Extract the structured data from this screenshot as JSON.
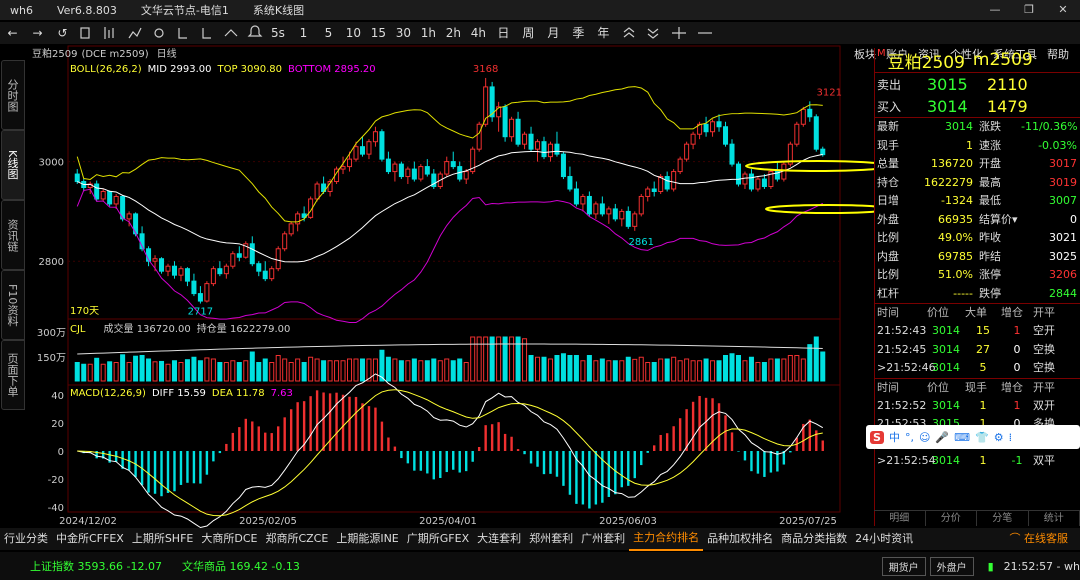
{
  "window": {
    "title": "wh6",
    "version": "Ver6.8.803",
    "server": "文华云节点-电信1",
    "screen": "系统K线图",
    "controls": [
      "—",
      "❐",
      "✕"
    ]
  },
  "toolbar": {
    "nav": [
      "←",
      "→",
      "↺"
    ],
    "periods": [
      "1",
      "5",
      "10",
      "15",
      "30",
      "1h",
      "2h",
      "4h",
      "日",
      "周",
      "月",
      "季",
      "年"
    ],
    "menu": [
      "板块",
      "账户",
      "资讯",
      "个性化",
      "系统工具",
      "帮助"
    ]
  },
  "left_tabs": [
    "分时图",
    "K线图",
    "资讯链",
    "F10资料",
    "页面下单"
  ],
  "chart": {
    "header": "豆粕2509",
    "header_code": "(DCE m2509)",
    "header_period": "日线",
    "boll_label": "BOLL(26,26,2)",
    "boll_mid": "MID 2993.00",
    "boll_top": "TOP 3090.80",
    "boll_bottom": "BOTTOM 2895.20",
    "price_ticks": [
      "3000",
      "2800"
    ],
    "annotations": {
      "high1": "3168",
      "high2": "3121",
      "low1": "2717",
      "low2": "2861",
      "days": "170天"
    },
    "vol_label": "CJL",
    "vol_text": "成交量 136720.00",
    "oi_text": "持仓量 1622279.00",
    "vol_ticks": [
      "300万",
      "150万"
    ],
    "macd_label": "MACD(12,26,9)",
    "macd_diff": "DIFF 15.59",
    "macd_dea": "DEA 11.78",
    "macd_val": "7.63",
    "macd_ticks": [
      "40",
      "20",
      "0",
      "-20",
      "-40"
    ],
    "dates": [
      "2024/12/02",
      "2025/02/05",
      "2025/04/01",
      "2025/06/03",
      "2025/07/25"
    ]
  },
  "chart_data": {
    "type": "candlestick",
    "price_range": [
      2690,
      3200
    ],
    "candles": [
      [
        2975,
        2985,
        2955,
        2960
      ],
      [
        2960,
        2965,
        2940,
        2948
      ],
      [
        2948,
        2960,
        2935,
        2955
      ],
      [
        2955,
        2962,
        2920,
        2925
      ],
      [
        2925,
        2945,
        2920,
        2940
      ],
      [
        2940,
        2942,
        2910,
        2915
      ],
      [
        2915,
        2935,
        2905,
        2930
      ],
      [
        2930,
        2932,
        2880,
        2885
      ],
      [
        2885,
        2900,
        2870,
        2895
      ],
      [
        2895,
        2898,
        2850,
        2855
      ],
      [
        2855,
        2870,
        2820,
        2825
      ],
      [
        2825,
        2830,
        2790,
        2800
      ],
      [
        2800,
        2812,
        2780,
        2805
      ],
      [
        2805,
        2808,
        2775,
        2780
      ],
      [
        2780,
        2795,
        2770,
        2790
      ],
      [
        2790,
        2800,
        2765,
        2772
      ],
      [
        2772,
        2790,
        2760,
        2785
      ],
      [
        2785,
        2788,
        2750,
        2760
      ],
      [
        2760,
        2775,
        2730,
        2735
      ],
      [
        2735,
        2750,
        2715,
        2720
      ],
      [
        2720,
        2760,
        2717,
        2755
      ],
      [
        2755,
        2790,
        2750,
        2785
      ],
      [
        2785,
        2800,
        2770,
        2775
      ],
      [
        2775,
        2795,
        2765,
        2790
      ],
      [
        2790,
        2820,
        2785,
        2815
      ],
      [
        2815,
        2830,
        2800,
        2808
      ],
      [
        2808,
        2840,
        2805,
        2835
      ],
      [
        2835,
        2850,
        2790,
        2795
      ],
      [
        2795,
        2800,
        2770,
        2780
      ],
      [
        2780,
        2800,
        2760,
        2765
      ],
      [
        2765,
        2790,
        2760,
        2785
      ],
      [
        2785,
        2830,
        2780,
        2825
      ],
      [
        2825,
        2860,
        2820,
        2855
      ],
      [
        2855,
        2880,
        2850,
        2875
      ],
      [
        2875,
        2900,
        2860,
        2895
      ],
      [
        2895,
        2910,
        2880,
        2888
      ],
      [
        2888,
        2930,
        2885,
        2925
      ],
      [
        2925,
        2960,
        2920,
        2955
      ],
      [
        2955,
        2970,
        2935,
        2940
      ],
      [
        2940,
        2965,
        2930,
        2960
      ],
      [
        2960,
        2990,
        2955,
        2985
      ],
      [
        2985,
        3010,
        2975,
        2990
      ],
      [
        2990,
        3020,
        2980,
        3005
      ],
      [
        3005,
        3040,
        3000,
        3030
      ],
      [
        3030,
        3050,
        3010,
        3015
      ],
      [
        3015,
        3045,
        3005,
        3040
      ],
      [
        3040,
        3070,
        3030,
        3060
      ],
      [
        3060,
        3065,
        3000,
        3005
      ],
      [
        3005,
        3020,
        2975,
        2980
      ],
      [
        2980,
        3000,
        2960,
        2995
      ],
      [
        2995,
        3000,
        2965,
        2970
      ],
      [
        2970,
        2990,
        2955,
        2985
      ],
      [
        2985,
        3000,
        2960,
        2965
      ],
      [
        2965,
        2995,
        2960,
        2990
      ],
      [
        2990,
        3005,
        2970,
        2975
      ],
      [
        2975,
        2985,
        2945,
        2950
      ],
      [
        2950,
        2980,
        2945,
        2975
      ],
      [
        2975,
        3010,
        2970,
        3000
      ],
      [
        3000,
        3020,
        2985,
        2990
      ],
      [
        2990,
        3000,
        2960,
        2965
      ],
      [
        2965,
        2985,
        2955,
        2980
      ],
      [
        2980,
        3030,
        2975,
        3025
      ],
      [
        3025,
        3080,
        3020,
        3075
      ],
      [
        3075,
        3168,
        3070,
        3150
      ],
      [
        3150,
        3160,
        3080,
        3090
      ],
      [
        3090,
        3120,
        3060,
        3110
      ],
      [
        3110,
        3115,
        3040,
        3050
      ],
      [
        3050,
        3090,
        3040,
        3085
      ],
      [
        3085,
        3100,
        3030,
        3035
      ],
      [
        3035,
        3060,
        3025,
        3055
      ],
      [
        3055,
        3070,
        3020,
        3025
      ],
      [
        3025,
        3045,
        3000,
        3040
      ],
      [
        3040,
        3050,
        3005,
        3010
      ],
      [
        3010,
        3040,
        3000,
        3035
      ],
      [
        3035,
        3060,
        3010,
        3015
      ],
      [
        3015,
        3020,
        2965,
        2970
      ],
      [
        2970,
        2990,
        2940,
        2945
      ],
      [
        2945,
        2960,
        2910,
        2915
      ],
      [
        2915,
        2935,
        2900,
        2930
      ],
      [
        2930,
        2940,
        2890,
        2895
      ],
      [
        2895,
        2920,
        2885,
        2915
      ],
      [
        2915,
        2930,
        2890,
        2895
      ],
      [
        2895,
        2910,
        2875,
        2905
      ],
      [
        2905,
        2915,
        2880,
        2885
      ],
      [
        2885,
        2905,
        2870,
        2900
      ],
      [
        2900,
        2910,
        2865,
        2870
      ],
      [
        2870,
        2900,
        2861,
        2895
      ],
      [
        2895,
        2935,
        2890,
        2930
      ],
      [
        2930,
        2950,
        2920,
        2945
      ],
      [
        2945,
        2960,
        2930,
        2940
      ],
      [
        2940,
        2975,
        2935,
        2970
      ],
      [
        2970,
        2980,
        2940,
        2945
      ],
      [
        2945,
        2985,
        2940,
        2980
      ],
      [
        2980,
        3010,
        2975,
        3005
      ],
      [
        3005,
        3040,
        3000,
        3035
      ],
      [
        3035,
        3060,
        3025,
        3055
      ],
      [
        3055,
        3080,
        3045,
        3075
      ],
      [
        3075,
        3090,
        3050,
        3060
      ],
      [
        3060,
        3085,
        3050,
        3080
      ],
      [
        3080,
        3095,
        3060,
        3070
      ],
      [
        3070,
        3080,
        3030,
        3035
      ],
      [
        3035,
        3045,
        2990,
        2995
      ],
      [
        2995,
        3000,
        2950,
        2955
      ],
      [
        2955,
        2980,
        2945,
        2975
      ],
      [
        2975,
        2985,
        2940,
        2945
      ],
      [
        2945,
        2970,
        2940,
        2965
      ],
      [
        2965,
        2975,
        2945,
        2950
      ],
      [
        2950,
        2985,
        2945,
        2980
      ],
      [
        2980,
        3000,
        2960,
        2965
      ],
      [
        2965,
        3000,
        2960,
        2995
      ],
      [
        2995,
        3040,
        2990,
        3035
      ],
      [
        3035,
        3080,
        3030,
        3075
      ],
      [
        3075,
        3110,
        3070,
        3105
      ],
      [
        3105,
        3121,
        3080,
        3090
      ],
      [
        3090,
        3095,
        3020,
        3025
      ],
      [
        3025,
        3030,
        3010,
        3014
      ]
    ],
    "boll": {
      "mid": 2993.0,
      "top": 3090.8,
      "bottom": 2895.2
    }
  },
  "quote": {
    "name": "豆粕2509",
    "code": "m2509",
    "sell": {
      "label": "卖出",
      "price": "3015",
      "vol": "2110"
    },
    "buy": {
      "label": "买入",
      "price": "3014",
      "vol": "1479"
    },
    "stats": [
      [
        "最新",
        "3014",
        "涨跌",
        "-11/0.36%",
        "#3f3",
        "#3f3"
      ],
      [
        "现手",
        "1",
        "速涨",
        "-0.03%",
        "#ff3",
        "#3f3"
      ],
      [
        "总量",
        "136720",
        "开盘",
        "3017",
        "#ff3",
        "#f33"
      ],
      [
        "持仓",
        "1622279",
        "最高",
        "3019",
        "#ff3",
        "#f33"
      ],
      [
        "日增",
        "-1324",
        "最低",
        "3007",
        "#ff3",
        "#3f3"
      ],
      [
        "外盘",
        "66935",
        "结算价▾",
        "0",
        "#ff3",
        "#fff"
      ],
      [
        "比例",
        "49.0%",
        "昨收",
        "3021",
        "#ff3",
        "#fff"
      ],
      [
        "内盘",
        "69785",
        "昨结",
        "3025",
        "#ff3",
        "#fff"
      ],
      [
        "比例",
        "51.0%",
        "涨停",
        "3206",
        "#ff3",
        "#f33"
      ],
      [
        "杠杆",
        "-----",
        "跌停",
        "2844",
        "#ff3",
        "#3f3"
      ]
    ],
    "tick_header": [
      "时间",
      "价位",
      "大单",
      "增仓",
      "开平"
    ],
    "ticks1": [
      [
        "21:52:43",
        "3014",
        "15",
        "1",
        "空开"
      ],
      [
        "21:52:45",
        "3014",
        "27",
        "0",
        "空换"
      ],
      [
        ">21:52:46",
        "3014",
        "5",
        "0",
        "空换"
      ]
    ],
    "tick_header2": [
      "时间",
      "价位",
      "现手",
      "增仓",
      "开平"
    ],
    "ticks2": [
      [
        "21:52:52",
        "3014",
        "1",
        "1",
        "双开"
      ],
      [
        "21:52:53",
        "3015",
        "1",
        "0",
        "多换"
      ],
      [
        "21:52:54",
        "3014",
        "1",
        "-1",
        "双平"
      ],
      [
        ">21:52:54",
        "3014",
        "1",
        "-1",
        "双平"
      ]
    ],
    "tick_colors": {
      "1": "#f33",
      "0": "#fff",
      "-1": "#3f3"
    },
    "right_tabs": [
      "明细",
      "分价",
      "分笔",
      "统计"
    ]
  },
  "ime": {
    "logo": "S",
    "items": [
      "中",
      "°,",
      "☺",
      "🎤",
      "⌨",
      "👕",
      "⚙",
      "⁞"
    ]
  },
  "categories": [
    "行业分类",
    "中金所CFFEX",
    "上期所SHFE",
    "大商所DCE",
    "郑商所CZCE",
    "上期能源INE",
    "广期所GFEX",
    "大连套利",
    "郑州套利",
    "广州套利",
    "主力合约排名",
    "品种加权排名",
    "商品分类指数",
    "24小时资讯"
  ],
  "active_category": "主力合约排名",
  "online": "在线客服",
  "status": {
    "idx1": "上证指数 3593.66 -12.07",
    "idx2": "文华商品 169.42 -0.13",
    "btn1": "期货户",
    "btn2": "外盘户",
    "time": "21:52:57 - wh"
  },
  "colors": {
    "up": "#f03030",
    "down": "#00e0e0",
    "mid": "#ffffff",
    "top": "#e0e000",
    "bottom": "#d000d0"
  }
}
